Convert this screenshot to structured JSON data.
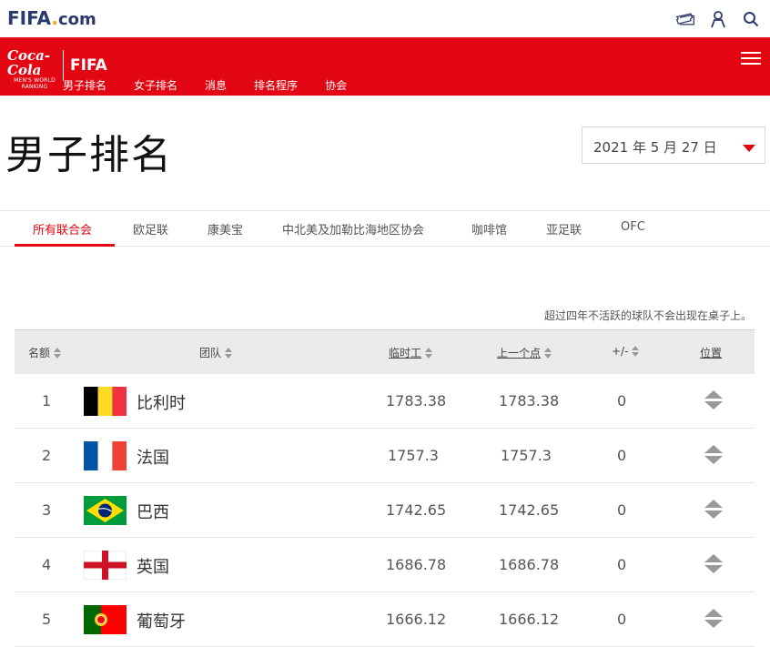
{
  "header": {
    "logo_fifa": "FIFA",
    "logo_com": "com",
    "icons": [
      "ticket-icon",
      "user-icon",
      "search-icon"
    ]
  },
  "sponsor": {
    "brand": "Coca-Cola",
    "line1": "MEN'S WORLD",
    "line2": "RANKING",
    "fifa": "FIFA"
  },
  "nav": {
    "items": [
      {
        "label": "男子排名",
        "active": true
      },
      {
        "label": "女子排名"
      },
      {
        "label": "消息"
      },
      {
        "label": "排名程序"
      },
      {
        "label": "协会"
      }
    ]
  },
  "page": {
    "title": "男子排名",
    "date": "2021 年 5 月 27 日"
  },
  "tabs": [
    {
      "label": "所有联合会",
      "active": true
    },
    {
      "label": "欧足联"
    },
    {
      "label": "康美宝"
    },
    {
      "label": "中北美及加勒比海地区协会"
    },
    {
      "label": "咖啡馆"
    },
    {
      "label": "亚足联"
    },
    {
      "label": "OFC"
    }
  ],
  "note": "超过四年不活跃的球队不会出现在桌子上。",
  "table": {
    "headers": {
      "rank": "名额",
      "team": "团队",
      "points": "临时工",
      "previous": "上一个点",
      "diff": "+/-",
      "position": "位置"
    },
    "rows": [
      {
        "rank": "1",
        "team": "比利时",
        "points": "1783.38",
        "previous": "1783.38",
        "diff": "0",
        "flag": "belgium"
      },
      {
        "rank": "2",
        "team": "法国",
        "points": "1757.3",
        "previous": "1757.3",
        "diff": "0",
        "flag": "france"
      },
      {
        "rank": "3",
        "team": "巴西",
        "points": "1742.65",
        "previous": "1742.65",
        "diff": "0",
        "flag": "brazil"
      },
      {
        "rank": "4",
        "team": "英国",
        "points": "1686.78",
        "previous": "1686.78",
        "diff": "0",
        "flag": "england"
      },
      {
        "rank": "5",
        "team": "葡萄牙",
        "points": "1666.12",
        "previous": "1666.12",
        "diff": "0",
        "flag": "portugal"
      }
    ]
  },
  "colors": {
    "brand_red": "#e30613",
    "fifa_blue": "#2a3a6e"
  }
}
